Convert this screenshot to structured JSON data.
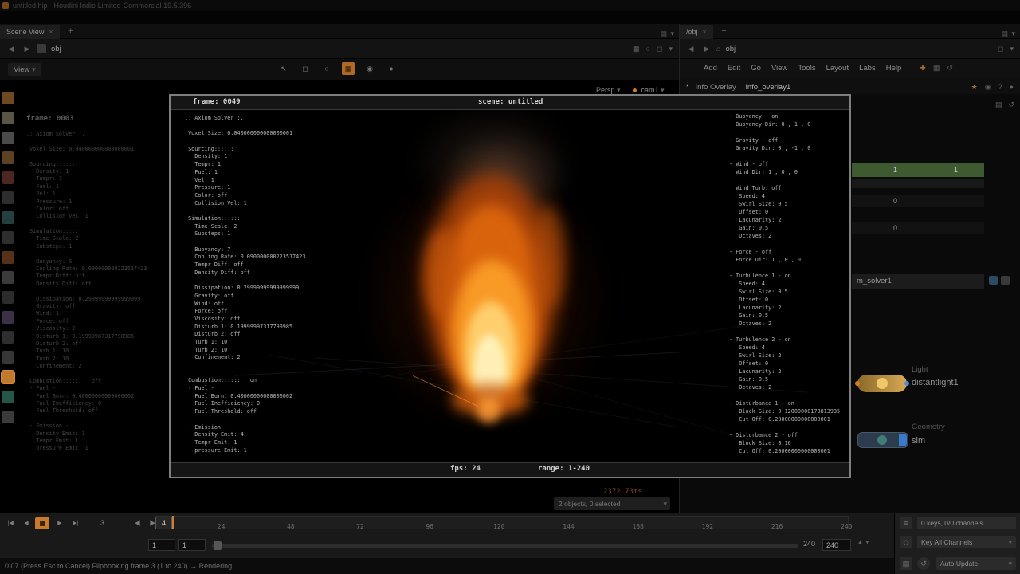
{
  "window": {
    "title": "untitled.hip - Houdini Indie Limited-Commercial 19.5.396"
  },
  "colors": {
    "accent_orange": "#c87a2c",
    "param_green": "#3d5a31",
    "node_light_yellow": "#d8a855",
    "node_geo_blue": "#31506b",
    "display_flag_blue": "#3a7ac8"
  },
  "icons": {
    "close": "×",
    "plus": "+",
    "back": "◀",
    "forward": "▶",
    "chevron_down": "▾",
    "home": "⌂",
    "pane_menu": "▤",
    "select_arrow": "↖",
    "box_tool": "◻",
    "grid_tool": "▦",
    "camera_tool": "◉",
    "circle_tool": "○",
    "dot": "●",
    "star": "★",
    "question": "?",
    "list": "≡",
    "refresh": "↺",
    "key": "◇",
    "asterisk": "*",
    "jump_start": "|◀",
    "reverse": "◀",
    "stop": "■",
    "play": "▶",
    "jump_end": "▶|",
    "step_back": "◀|",
    "step_forward": "|▶",
    "spin_arrows": "▲▼",
    "wrench_tool": "✚"
  },
  "left_pane": {
    "tab": "Scene View",
    "breadcrumb": "obj",
    "view_menu": "View"
  },
  "left_toolbar": {
    "tools": [
      {
        "color": "#8a5a28"
      },
      {
        "color": "#6f6a55"
      },
      {
        "color": "#5c5c5c"
      },
      {
        "color": "#74512c"
      },
      {
        "color": "#5f2f2b"
      },
      {
        "color": "#3a3a3a"
      },
      {
        "color": "#2e4f4f"
      },
      {
        "color": "#3a3a3a"
      },
      {
        "color": "#6b3d1f"
      },
      {
        "color": "#4a4a4a"
      },
      {
        "color": "#373737"
      },
      {
        "color": "#4a3c58"
      },
      {
        "color": "#3a3a3a"
      },
      {
        "color": "#444444"
      },
      {
        "color": "#c07a2e"
      },
      {
        "color": "#2f6b5a"
      },
      {
        "color": "#4a4a4a"
      }
    ]
  },
  "viewport": {
    "frame_label": "frame: 0003",
    "persp": "Persp",
    "cam": "cam1",
    "stats_ms": "2372.73ms",
    "stats_objects": "2 objects, 0 selected",
    "lines": [
      ".: Axiom Solver :.",
      "",
      " Voxel Size: 0.040000000000000001",
      "",
      " Sourcing::::::",
      "   Density: 1",
      "   Tempr: 1",
      "   Fuel: 1",
      "   Vel: 1",
      "   Pressure: 1",
      "   Color: off",
      "   Collision Vel: 1",
      "",
      " Simulation::::::",
      "   Time Scale: 2",
      "   Substeps: 1",
      "",
      "   Buoyancy: 6",
      "   Cooling Rate: 0.090000000223517423",
      "   Tempr Diff: off",
      "   Density Diff: off",
      "",
      "   Dissipation: 0.29999999999999999",
      "   Gravity: off",
      "   Wind: 1",
      "   Force: off",
      "   Viscosity: 2",
      "   Disturb 1: 0.19999987317790985",
      "   Disturb 2: off",
      "   Turb 1: 10",
      "   Turb 2: 10",
      "   Confinement: 2",
      "",
      " Combustion::::::   off",
      " - Fuel -",
      "   Fuel Burn: 0.40000000000000002",
      "   Fuel Inefficiency: 0",
      "   Fuel Threshold: off",
      "",
      " - Emission -",
      "   Density Emit: 1",
      "   Tempr Emit: 1",
      "   pressure Emit: 1"
    ]
  },
  "flipbook": {
    "frame": "frame: 0049",
    "scene": "scene: untitled",
    "fps": "fps: 24",
    "range": "range: 1-240",
    "left_lines": [
      ".: Axiom Solver :.",
      "",
      " Voxel Size: 0.040000000000000001",
      "",
      " Sourcing::::::",
      "   Density: 1",
      "   Tempr: 1",
      "   Fuel: 1",
      "   Vel: 1",
      "   Pressure: 1",
      "   Color: off",
      "   Collision Vel: 1",
      "",
      " Simulation::::::",
      "   Time Scale: 2",
      "   Substeps: 1",
      "",
      "   Buoyancy: 7",
      "   Cooling Rate: 0.090000000223517423",
      "   Tempr Diff: off",
      "   Density Diff: off",
      "",
      "   Dissipation: 0.29999999999999999",
      "   Gravity: off",
      "   Wind: off",
      "   Force: off",
      "   Viscosity: off",
      "   Disturb 1: 0.19999997317790985",
      "   Disturb 2: off",
      "   Turb 1: 10",
      "   Turb 2: 10",
      "   Confinement: 2",
      "",
      "",
      " Combustion::::::   on",
      " - Fuel -",
      "   Fuel Burn: 0.40000000000000002",
      "   Fuel Inefficiency: 0",
      "   Fuel Threshold: off",
      "",
      " - Emission -",
      "   Density Emit: 4",
      "   Tempr Emit: 1",
      "   pressure Emit: 1"
    ],
    "right_lines": [
      "- Buoyancy - on",
      "  Buoyancy Dir: 0 , 1 , 0",
      "",
      "- Gravity - off",
      "  Gravity Dir: 0 , -1 , 0",
      "",
      "- Wind - off",
      "  Wind Dir: 1 , 0 , 0",
      "",
      "  Wind Turb: off",
      "   Speed: 4",
      "   Swirl Size: 0.5",
      "   Offset: 0",
      "   Lacunarity: 2",
      "   Gain: 0.5",
      "   Octaves: 2",
      "",
      "- Force - off",
      "  Force Dir: 1 , 0 , 0",
      "",
      "- Turbulence 1 - on",
      "   Speed: 4",
      "   Swirl Size: 0.5",
      "   Offset: 0",
      "   Lacunarity: 2",
      "   Gain: 0.5",
      "   Octaves: 2",
      "",
      "- Turbulence 2 - on",
      "   Speed: 4",
      "   Swirl Size: 2",
      "   Offset: 0",
      "   Lacunarity: 2",
      "   Gain: 0.5",
      "   Octaves: 2",
      "",
      "- Disturbance 1 - on",
      "   Block Size: 0.12000000178813935",
      "   Cut Off: 0.20000000000000001",
      "",
      "- Disturbance 2 - off",
      "   Block Size: 0.16",
      "   Cut Off: 0.20000000000000001"
    ]
  },
  "right_pane": {
    "tab": "/obj",
    "breadcrumb": "obj",
    "menus": [
      "Add",
      "Edit",
      "Go",
      "View",
      "Tools",
      "Layout",
      "Labs",
      "Help"
    ],
    "overlay_label": "Info Overlay",
    "overlay_node": "info_overlay1",
    "params": {
      "value_a": "1",
      "value_b": "1",
      "value_c": "0",
      "value_d": "0"
    },
    "nodes": {
      "solver": "m_solver1",
      "light_type": "Light",
      "light_name": "distantlight1",
      "geo_type": "Geometry",
      "geo_name": "sim"
    }
  },
  "timeline": {
    "current_frame": "4",
    "playback_frame": "3",
    "ticks": [
      "24",
      "48",
      "72",
      "96",
      "120",
      "144",
      "168",
      "192",
      "216",
      "240"
    ],
    "range_start": "1",
    "playback_start": "1",
    "range_end_label": "240",
    "range_end": "240"
  },
  "bottom_right": {
    "keys_info": "0 keys, 0/0 channels",
    "key_all": "Key All Channels",
    "auto_update": "Auto Update"
  },
  "status_bar": {
    "message": "0:07 (Press Esc to Cancel) Flipbooking frame 3 (1 to 240)  →  Rendering"
  }
}
